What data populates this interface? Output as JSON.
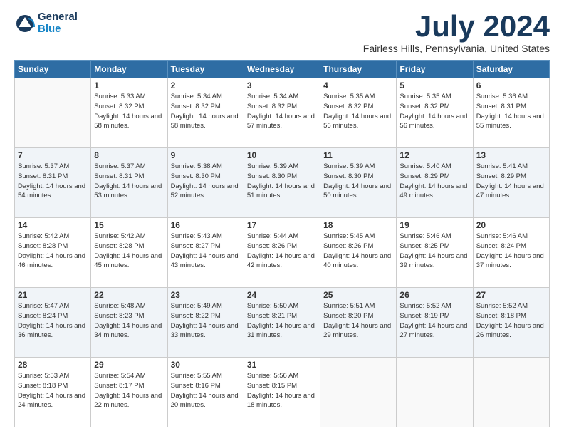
{
  "logo": {
    "general": "General",
    "blue": "Blue"
  },
  "title": "July 2024",
  "location": "Fairless Hills, Pennsylvania, United States",
  "days_of_week": [
    "Sunday",
    "Monday",
    "Tuesday",
    "Wednesday",
    "Thursday",
    "Friday",
    "Saturday"
  ],
  "weeks": [
    [
      {
        "day": "",
        "sunrise": "",
        "sunset": "",
        "daylight": ""
      },
      {
        "day": "1",
        "sunrise": "Sunrise: 5:33 AM",
        "sunset": "Sunset: 8:32 PM",
        "daylight": "Daylight: 14 hours and 58 minutes."
      },
      {
        "day": "2",
        "sunrise": "Sunrise: 5:34 AM",
        "sunset": "Sunset: 8:32 PM",
        "daylight": "Daylight: 14 hours and 58 minutes."
      },
      {
        "day": "3",
        "sunrise": "Sunrise: 5:34 AM",
        "sunset": "Sunset: 8:32 PM",
        "daylight": "Daylight: 14 hours and 57 minutes."
      },
      {
        "day": "4",
        "sunrise": "Sunrise: 5:35 AM",
        "sunset": "Sunset: 8:32 PM",
        "daylight": "Daylight: 14 hours and 56 minutes."
      },
      {
        "day": "5",
        "sunrise": "Sunrise: 5:35 AM",
        "sunset": "Sunset: 8:32 PM",
        "daylight": "Daylight: 14 hours and 56 minutes."
      },
      {
        "day": "6",
        "sunrise": "Sunrise: 5:36 AM",
        "sunset": "Sunset: 8:31 PM",
        "daylight": "Daylight: 14 hours and 55 minutes."
      }
    ],
    [
      {
        "day": "7",
        "sunrise": "Sunrise: 5:37 AM",
        "sunset": "Sunset: 8:31 PM",
        "daylight": "Daylight: 14 hours and 54 minutes."
      },
      {
        "day": "8",
        "sunrise": "Sunrise: 5:37 AM",
        "sunset": "Sunset: 8:31 PM",
        "daylight": "Daylight: 14 hours and 53 minutes."
      },
      {
        "day": "9",
        "sunrise": "Sunrise: 5:38 AM",
        "sunset": "Sunset: 8:30 PM",
        "daylight": "Daylight: 14 hours and 52 minutes."
      },
      {
        "day": "10",
        "sunrise": "Sunrise: 5:39 AM",
        "sunset": "Sunset: 8:30 PM",
        "daylight": "Daylight: 14 hours and 51 minutes."
      },
      {
        "day": "11",
        "sunrise": "Sunrise: 5:39 AM",
        "sunset": "Sunset: 8:30 PM",
        "daylight": "Daylight: 14 hours and 50 minutes."
      },
      {
        "day": "12",
        "sunrise": "Sunrise: 5:40 AM",
        "sunset": "Sunset: 8:29 PM",
        "daylight": "Daylight: 14 hours and 49 minutes."
      },
      {
        "day": "13",
        "sunrise": "Sunrise: 5:41 AM",
        "sunset": "Sunset: 8:29 PM",
        "daylight": "Daylight: 14 hours and 47 minutes."
      }
    ],
    [
      {
        "day": "14",
        "sunrise": "Sunrise: 5:42 AM",
        "sunset": "Sunset: 8:28 PM",
        "daylight": "Daylight: 14 hours and 46 minutes."
      },
      {
        "day": "15",
        "sunrise": "Sunrise: 5:42 AM",
        "sunset": "Sunset: 8:28 PM",
        "daylight": "Daylight: 14 hours and 45 minutes."
      },
      {
        "day": "16",
        "sunrise": "Sunrise: 5:43 AM",
        "sunset": "Sunset: 8:27 PM",
        "daylight": "Daylight: 14 hours and 43 minutes."
      },
      {
        "day": "17",
        "sunrise": "Sunrise: 5:44 AM",
        "sunset": "Sunset: 8:26 PM",
        "daylight": "Daylight: 14 hours and 42 minutes."
      },
      {
        "day": "18",
        "sunrise": "Sunrise: 5:45 AM",
        "sunset": "Sunset: 8:26 PM",
        "daylight": "Daylight: 14 hours and 40 minutes."
      },
      {
        "day": "19",
        "sunrise": "Sunrise: 5:46 AM",
        "sunset": "Sunset: 8:25 PM",
        "daylight": "Daylight: 14 hours and 39 minutes."
      },
      {
        "day": "20",
        "sunrise": "Sunrise: 5:46 AM",
        "sunset": "Sunset: 8:24 PM",
        "daylight": "Daylight: 14 hours and 37 minutes."
      }
    ],
    [
      {
        "day": "21",
        "sunrise": "Sunrise: 5:47 AM",
        "sunset": "Sunset: 8:24 PM",
        "daylight": "Daylight: 14 hours and 36 minutes."
      },
      {
        "day": "22",
        "sunrise": "Sunrise: 5:48 AM",
        "sunset": "Sunset: 8:23 PM",
        "daylight": "Daylight: 14 hours and 34 minutes."
      },
      {
        "day": "23",
        "sunrise": "Sunrise: 5:49 AM",
        "sunset": "Sunset: 8:22 PM",
        "daylight": "Daylight: 14 hours and 33 minutes."
      },
      {
        "day": "24",
        "sunrise": "Sunrise: 5:50 AM",
        "sunset": "Sunset: 8:21 PM",
        "daylight": "Daylight: 14 hours and 31 minutes."
      },
      {
        "day": "25",
        "sunrise": "Sunrise: 5:51 AM",
        "sunset": "Sunset: 8:20 PM",
        "daylight": "Daylight: 14 hours and 29 minutes."
      },
      {
        "day": "26",
        "sunrise": "Sunrise: 5:52 AM",
        "sunset": "Sunset: 8:19 PM",
        "daylight": "Daylight: 14 hours and 27 minutes."
      },
      {
        "day": "27",
        "sunrise": "Sunrise: 5:52 AM",
        "sunset": "Sunset: 8:18 PM",
        "daylight": "Daylight: 14 hours and 26 minutes."
      }
    ],
    [
      {
        "day": "28",
        "sunrise": "Sunrise: 5:53 AM",
        "sunset": "Sunset: 8:18 PM",
        "daylight": "Daylight: 14 hours and 24 minutes."
      },
      {
        "day": "29",
        "sunrise": "Sunrise: 5:54 AM",
        "sunset": "Sunset: 8:17 PM",
        "daylight": "Daylight: 14 hours and 22 minutes."
      },
      {
        "day": "30",
        "sunrise": "Sunrise: 5:55 AM",
        "sunset": "Sunset: 8:16 PM",
        "daylight": "Daylight: 14 hours and 20 minutes."
      },
      {
        "day": "31",
        "sunrise": "Sunrise: 5:56 AM",
        "sunset": "Sunset: 8:15 PM",
        "daylight": "Daylight: 14 hours and 18 minutes."
      },
      {
        "day": "",
        "sunrise": "",
        "sunset": "",
        "daylight": ""
      },
      {
        "day": "",
        "sunrise": "",
        "sunset": "",
        "daylight": ""
      },
      {
        "day": "",
        "sunrise": "",
        "sunset": "",
        "daylight": ""
      }
    ]
  ]
}
